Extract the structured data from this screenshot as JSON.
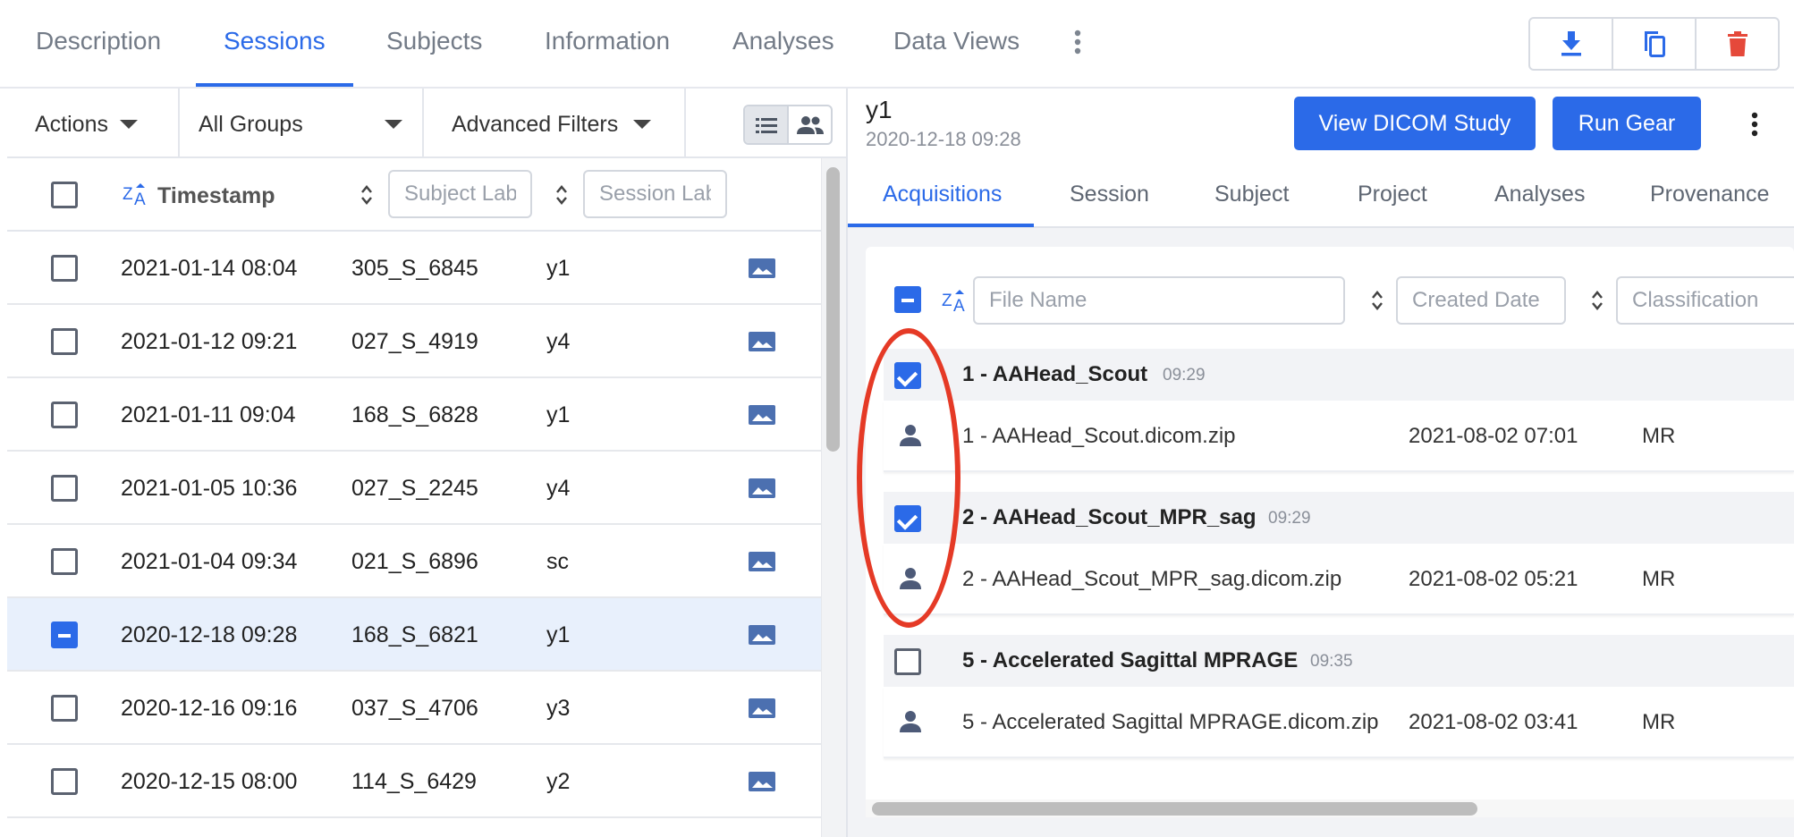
{
  "top_tabs": [
    {
      "label": "Description"
    },
    {
      "label": "Sessions",
      "active": true
    },
    {
      "label": "Subjects"
    },
    {
      "label": "Information"
    },
    {
      "label": "Analyses"
    },
    {
      "label": "Data Views"
    }
  ],
  "toolbar": {
    "actions_label": "Actions",
    "group_label": "All Groups",
    "filters_label": "Advanced Filters"
  },
  "table": {
    "timestamp_header": "Timestamp",
    "subject_placeholder": "Subject Label",
    "session_placeholder": "Session Label",
    "rows": [
      {
        "timestamp": "2021-01-14 08:04",
        "subject": "305_S_6845",
        "session": "y1"
      },
      {
        "timestamp": "2021-01-12 09:21",
        "subject": "027_S_4919",
        "session": "y4"
      },
      {
        "timestamp": "2021-01-11 09:04",
        "subject": "168_S_6828",
        "session": "y1"
      },
      {
        "timestamp": "2021-01-05 10:36",
        "subject": "027_S_2245",
        "session": "y4"
      },
      {
        "timestamp": "2021-01-04 09:34",
        "subject": "021_S_6896",
        "session": "sc"
      },
      {
        "timestamp": "2020-12-18 09:28",
        "subject": "168_S_6821",
        "session": "y1",
        "selected": true
      },
      {
        "timestamp": "2020-12-16 09:16",
        "subject": "037_S_4706",
        "session": "y3"
      },
      {
        "timestamp": "2020-12-15 08:00",
        "subject": "114_S_6429",
        "session": "y2"
      }
    ]
  },
  "session": {
    "title": "y1",
    "date": "2020-12-18 09:28",
    "view_dicom_label": "View DICOM Study",
    "run_gear_label": "Run Gear"
  },
  "sub_tabs": [
    {
      "label": "Acquisitions",
      "active": true
    },
    {
      "label": "Session"
    },
    {
      "label": "Subject"
    },
    {
      "label": "Project"
    },
    {
      "label": "Analyses"
    },
    {
      "label": "Provenance"
    }
  ],
  "files": {
    "filename_placeholder": "File Name",
    "created_placeholder": "Created Date",
    "classification_placeholder": "Classification",
    "acquisitions": [
      {
        "title": "1 - AAHead_Scout",
        "time": "09:29",
        "checked": true,
        "file": {
          "name": "1 - AAHead_Scout.dicom.zip",
          "created": "2021-08-02 07:01",
          "classification": "MR"
        }
      },
      {
        "title": "2 - AAHead_Scout_MPR_sag",
        "time": "09:29",
        "checked": true,
        "file": {
          "name": "2 - AAHead_Scout_MPR_sag.dicom.zip",
          "created": "2021-08-02 05:21",
          "classification": "MR"
        }
      },
      {
        "title": "5 - Accelerated Sagittal MPRAGE",
        "time": "09:35",
        "checked": false,
        "file": {
          "name": "5 - Accelerated Sagittal MPRAGE.dicom.zip",
          "created": "2021-08-02 03:41",
          "classification": "MR"
        }
      }
    ]
  },
  "colors": {
    "accent": "#2b6ae8",
    "delete": "#e5493a",
    "annotation": "#e53a26"
  },
  "icons": [
    "download-icon",
    "copy-icon",
    "trash-icon",
    "more-vertical-icon",
    "list-view-icon",
    "group-view-icon",
    "sort-za-icon",
    "image-icon",
    "person-icon"
  ]
}
